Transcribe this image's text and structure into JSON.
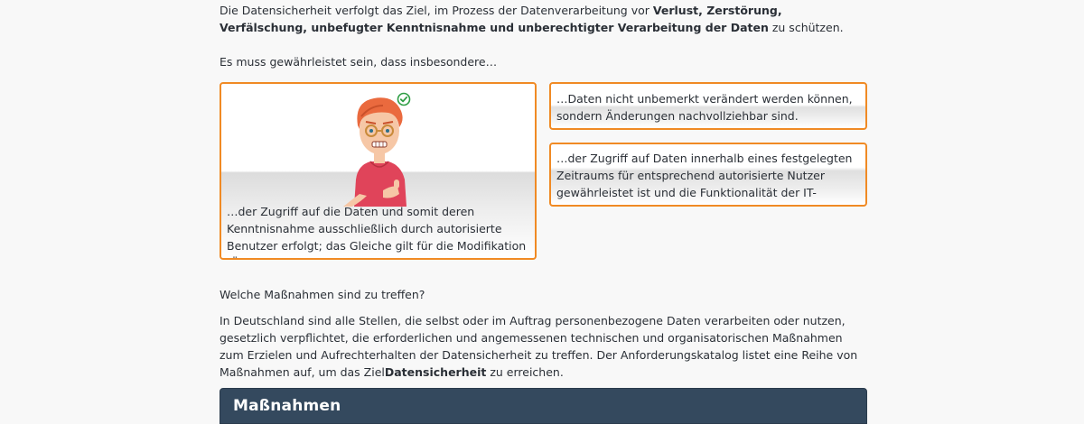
{
  "intro": {
    "text_before": "Die Datensicherheit verfolgt das Ziel, im Prozess der Datenverarbeitung vor ",
    "bold": "Verlust, Zerstörung, Verfälschung, unbefugter Kenntnisnahme und unberechtigter Verarbeitung der Daten",
    "text_after": " zu schützen."
  },
  "lead": "Es muss gewährleistet sein, dass insbesondere…",
  "cards": {
    "confidentiality": "…der Zugriff auf die Daten und somit deren Kenntnisnahme ausschließlich durch autorisierte Benutzer erfolgt; das Gleiche gilt für die Modifikation (Ändern und Löschen) von Daten.",
    "integrity": "…Daten nicht unbemerkt verändert werden können, sondern Änderungen nachvollziehbar sind.",
    "availability": "…der Zugriff auf Daten innerhalb eines festgelegten Zeitraums für entsprechend autorisierte Nutzer gewährleistet ist und die Funktionalität der IT-Systeme nicht beeinträchtigt ist."
  },
  "question": "Welche Maßnahmen sind zu treffen?",
  "paragraph": {
    "text_before": "In Deutschland sind alle Stellen, die selbst oder im Auftrag personenbezogene Daten verarbeiten oder nutzen, gesetzlich verpflichtet, die erforderlichen und angemessenen technischen und organisatorischen Maßnahmen zum Erzielen und Aufrechterhalten der Datensicherheit zu treffen. Der Anforderungskatalog listet eine Reihe von Maßnahmen auf, um das Ziel",
    "bold": "Datensicherheit",
    "text_after": " zu erreichen."
  },
  "panel": {
    "title": "Maßnahmen"
  },
  "icons": {
    "figure": "thumbs-up-person-icon",
    "badge": "check-circle-icon"
  },
  "colors": {
    "accent": "#f08a24",
    "panel": "#34495e",
    "check": "#2e9e44"
  }
}
